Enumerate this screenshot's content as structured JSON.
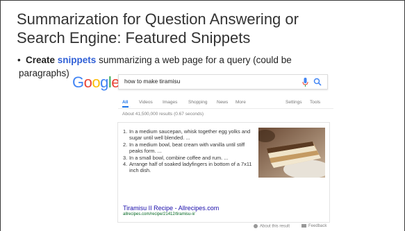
{
  "slide": {
    "title_line1": "Summarization for Question Answering or",
    "title_line2": "Search Engine: Featured Snippets",
    "bullet_dot": "•",
    "bullet_create": "Create",
    "bullet_snippets": "snippets",
    "bullet_rest": " summarizing a web page for a query (could be",
    "bullet_line2": "paragraphs)"
  },
  "google": {
    "logo_letters": [
      "G",
      "o",
      "o",
      "g",
      "l",
      "e"
    ],
    "search_query": "how to make tiramisu",
    "tabs": [
      "All",
      "Videos",
      "Images",
      "Shopping",
      "News",
      "More"
    ],
    "tools": [
      "Settings",
      "Tools"
    ],
    "results_count": "About 41,500,000 results (0.67 seconds)",
    "steps": [
      {
        "num": "1.",
        "text": "In a medium saucepan, whisk together egg yolks and sugar until well blended. ..."
      },
      {
        "num": "2.",
        "text": "In a medium bowl, beat cream with vanilla until stiff peaks form. ..."
      },
      {
        "num": "3.",
        "text": "In a small bowl, combine coffee and rum. ..."
      },
      {
        "num": "4.",
        "text": "Arrange half of soaked ladyfingers in bottom of a 7x11 inch dish."
      }
    ],
    "result_title": "Tiramisu II Recipe - Allrecipes.com",
    "result_url": "allrecipes.com/recipe/21412/tiramisu-ii/",
    "footer_about": "About this result",
    "footer_feedback": "Feedback"
  },
  "colors": {
    "google_blue": "#4285f4",
    "google_red": "#ea4335",
    "google_yellow": "#fbbc05",
    "google_green": "#34a853",
    "snippet_highlight": "#2f5fd6",
    "link_title": "#1a0dab",
    "link_url": "#006621"
  },
  "icons": [
    "mic-icon",
    "search-icon",
    "info-icon",
    "feedback-icon"
  ]
}
